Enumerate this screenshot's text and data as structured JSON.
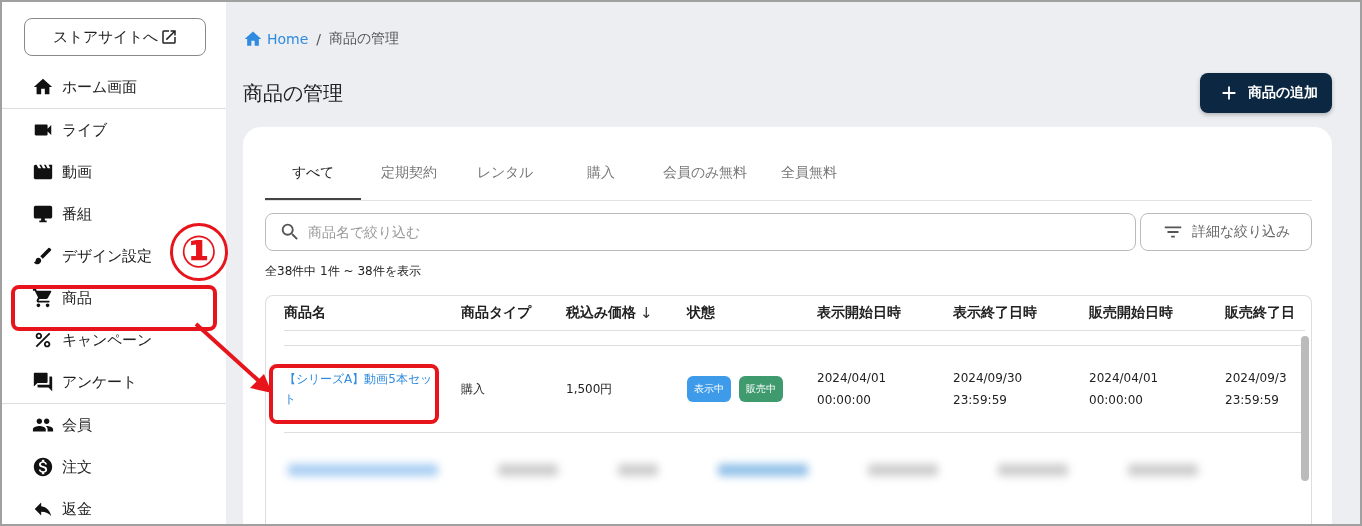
{
  "store_button": {
    "label": "ストアサイトへ"
  },
  "sidebar": {
    "sections": [
      [
        {
          "label": "ホーム画面"
        }
      ],
      [
        {
          "label": "ライブ"
        },
        {
          "label": "動画"
        },
        {
          "label": "番組"
        },
        {
          "label": "デザイン設定"
        },
        {
          "label": "商品"
        },
        {
          "label": "キャンペーン"
        },
        {
          "label": "アンケート"
        }
      ],
      [
        {
          "label": "会員"
        },
        {
          "label": "注文"
        },
        {
          "label": "返金"
        }
      ]
    ]
  },
  "breadcrumb": {
    "home": "Home",
    "separator": "/",
    "current": "商品の管理"
  },
  "page_title": "商品の管理",
  "add_button": {
    "label": "商品の追加"
  },
  "tabs": [
    {
      "label": "すべて",
      "selected": true
    },
    {
      "label": "定期契約",
      "selected": false
    },
    {
      "label": "レンタル",
      "selected": false
    },
    {
      "label": "購入",
      "selected": false
    },
    {
      "label": "会員のみ無料",
      "selected": false
    },
    {
      "label": "全員無料",
      "selected": false
    }
  ],
  "search": {
    "placeholder": "商品名で絞り込む"
  },
  "filter_button": {
    "label": "詳細な絞り込み"
  },
  "result_count": "全38件中 1件 ~ 38件を表示",
  "table": {
    "columns": [
      {
        "label": "商品名"
      },
      {
        "label": "商品タイプ"
      },
      {
        "label": "税込み価格",
        "sort_mark": "↓"
      },
      {
        "label": "状態"
      },
      {
        "label": "表示開始日時"
      },
      {
        "label": "表示終了日時"
      },
      {
        "label": "販売開始日時"
      },
      {
        "label": "販売終了日"
      }
    ],
    "rows": [
      {
        "name": "【シリーズA】動画5本セット",
        "type": "購入",
        "price": "1,500円",
        "badges": [
          {
            "label": "表示中",
            "color": "#3d9be9"
          },
          {
            "label": "販売中",
            "color": "#3f9a6e"
          }
        ],
        "dates": [
          [
            "2024/04/01",
            "00:00:00"
          ],
          [
            "2024/09/30",
            "23:59:59"
          ],
          [
            "2024/04/01",
            "00:00:00"
          ],
          [
            "2024/09/3",
            "23:59:59"
          ]
        ]
      }
    ]
  },
  "annotation": {
    "step": "①"
  }
}
